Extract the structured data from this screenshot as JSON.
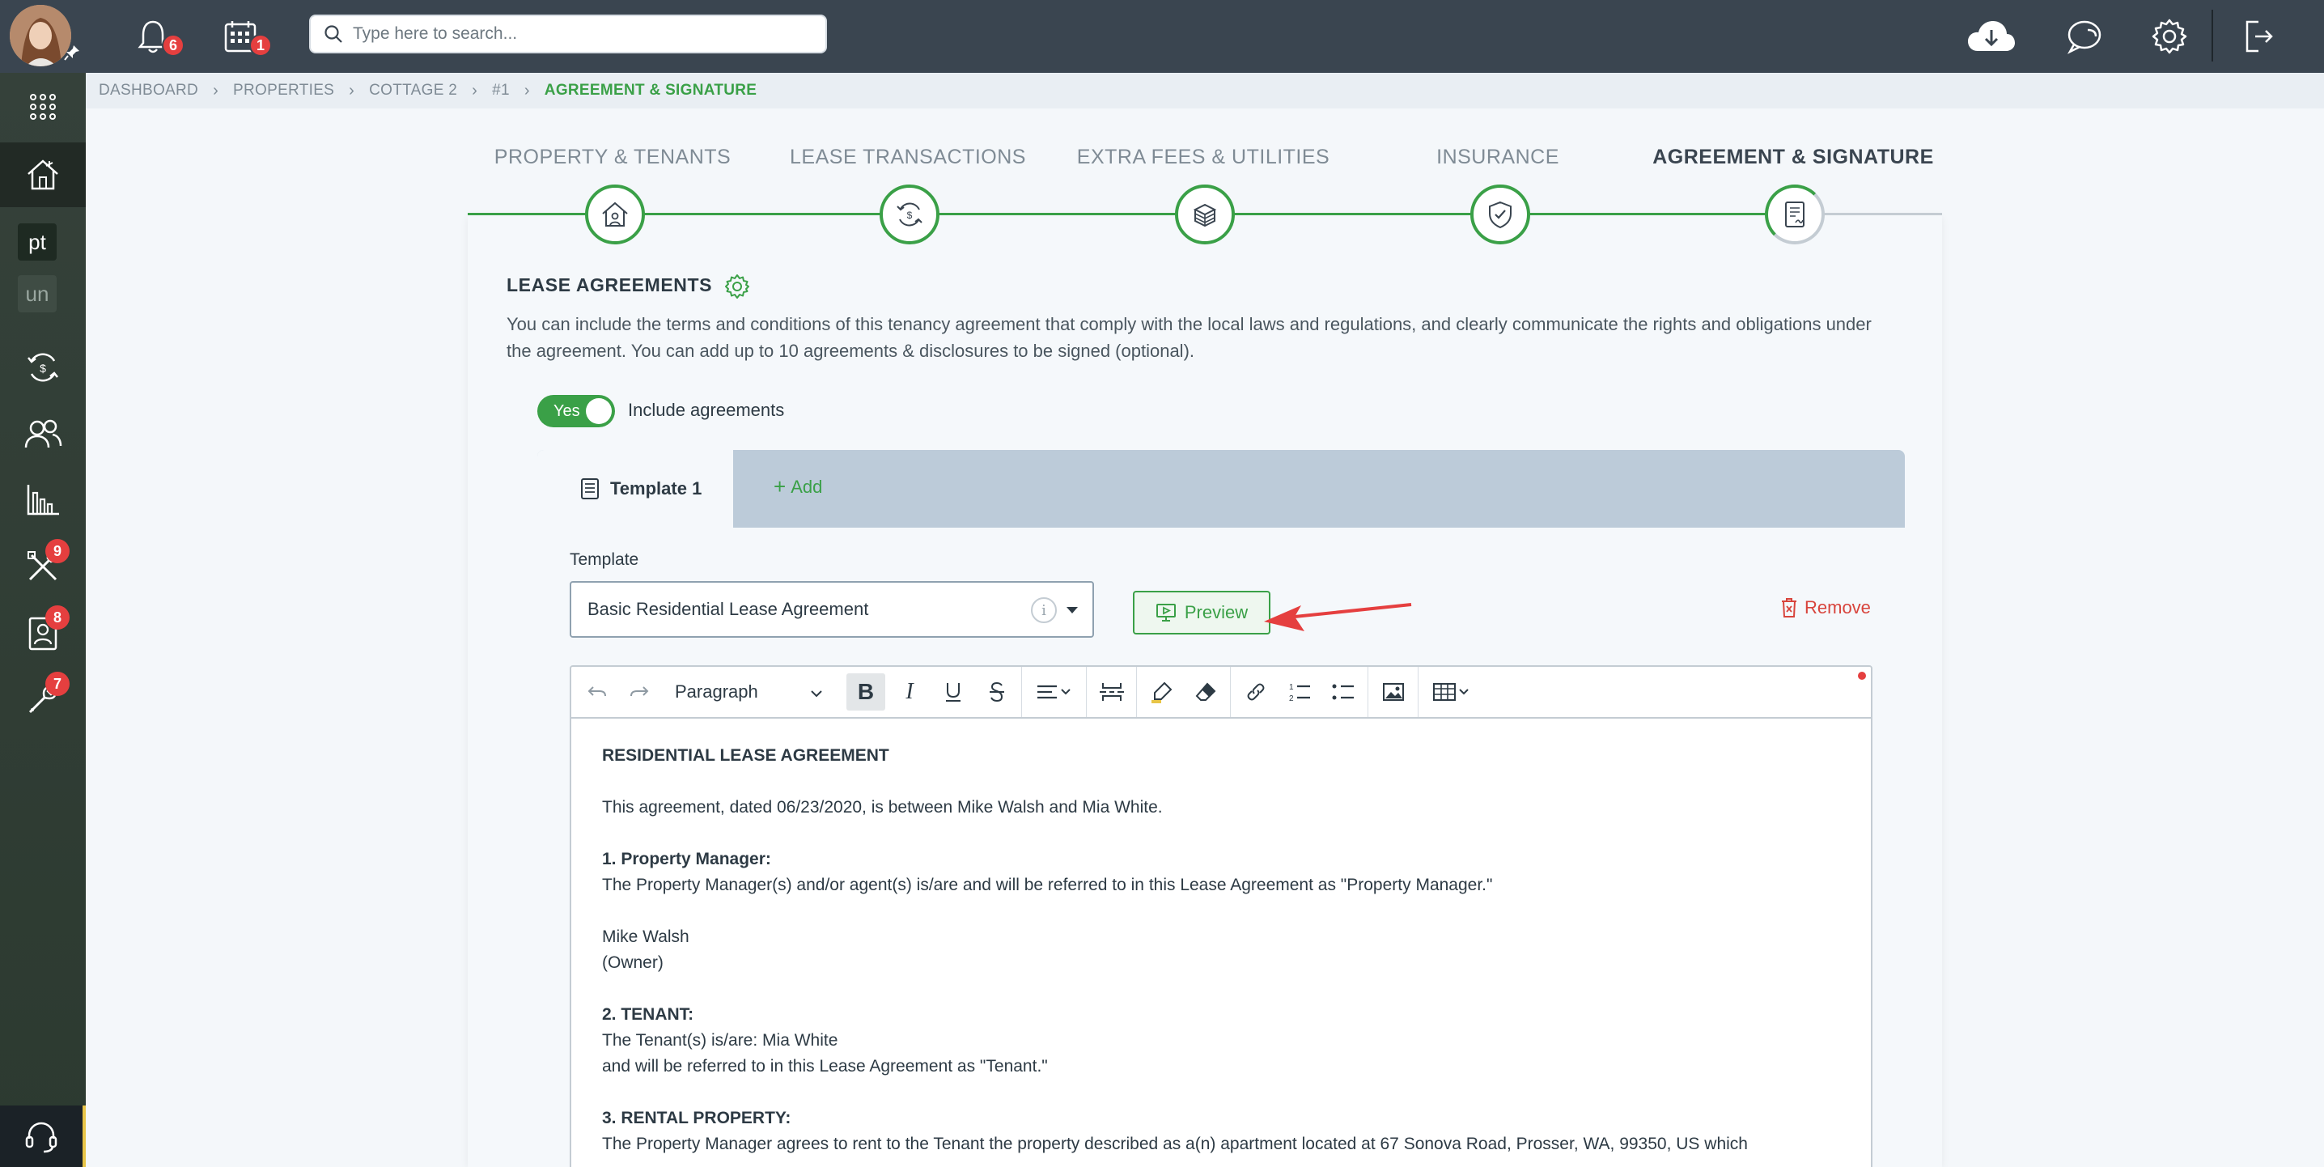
{
  "topbar": {
    "notifications_count": "6",
    "calendar_count": "1",
    "search_placeholder": "Type here to search..."
  },
  "sidebar": {
    "box1": "pt",
    "box2": "un",
    "tools_badge": "9",
    "contacts_badge": "8",
    "maintenance_badge": "7"
  },
  "breadcrumb": [
    "DASHBOARD",
    "PROPERTIES",
    "COTTAGE 2",
    "#1",
    "AGREEMENT & SIGNATURE"
  ],
  "steps": [
    {
      "label": "PROPERTY & TENANTS"
    },
    {
      "label": "LEASE TRANSACTIONS"
    },
    {
      "label": "EXTRA FEES & UTILITIES"
    },
    {
      "label": "INSURANCE"
    },
    {
      "label": "AGREEMENT & SIGNATURE"
    }
  ],
  "section": {
    "title": "LEASE AGREEMENTS",
    "description": "You can include the terms and conditions of this tenancy agreement that comply with the local laws and regulations, and clearly communicate the rights and obligations under the agreement. You can add up to 10 agreements & disclosures to be signed (optional)."
  },
  "toggle": {
    "state": "Yes",
    "label": "Include agreements"
  },
  "tabs": {
    "active": "Template 1",
    "add": "Add"
  },
  "template": {
    "label": "Template",
    "value": "Basic Residential Lease Agreement",
    "preview": "Preview",
    "remove": "Remove"
  },
  "editor": {
    "paragraph_style": "Paragraph",
    "doc": {
      "title": "RESIDENTIAL LEASE AGREEMENT",
      "intro": "This agreement, dated 06/23/2020, is between Mike Walsh and Mia White.",
      "s1_title": "1. Property Manager:",
      "s1_text": "The Property Manager(s) and/or agent(s) is/are and will be referred to in this Lease Agreement as \"Property Manager.\"",
      "s1_name": "Mike Walsh",
      "s1_role": "(Owner)",
      "s2_title": "2. TENANT:",
      "s2_text1": "The Tenant(s) is/are: Mia White",
      "s2_text2": "and will be referred to in this Lease Agreement as \"Tenant.\"",
      "s3_title": "3. RENTAL PROPERTY:",
      "s3_text": "The Property Manager agrees to rent to the Tenant the property described as a(n) apartment located at 67 Sonova Road, Prosser, WA, 99350, US which"
    }
  },
  "colors": {
    "accent": "#3aa047",
    "topbar": "#3a4550",
    "sidebar": "#35413a",
    "badge": "#e53f3f",
    "remove": "#d8443c"
  }
}
